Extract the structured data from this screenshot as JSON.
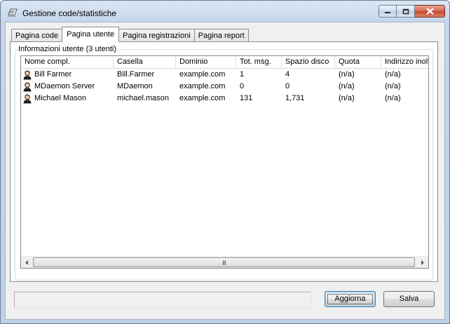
{
  "window": {
    "title": "Gestione code/statistiche"
  },
  "tabs": [
    {
      "label": "Pagina code"
    },
    {
      "label": "Pagina utente"
    },
    {
      "label": "Pagina registrazioni"
    },
    {
      "label": "Pagina report"
    }
  ],
  "active_tab": 1,
  "group": {
    "label": "Informazioni utente (3 utenti)"
  },
  "columns": [
    {
      "label": "Nome compl."
    },
    {
      "label": "Casella"
    },
    {
      "label": "Dominio"
    },
    {
      "label": "Tot. msg."
    },
    {
      "label": "Spazio disco"
    },
    {
      "label": "Quota"
    },
    {
      "label": "Indirizzo inolt"
    }
  ],
  "rows": [
    {
      "name": "Bill Farmer",
      "mailbox": "Bill.Farmer",
      "domain": "example.com",
      "messages": "1",
      "disk": "4",
      "quota": "(n/a)",
      "forward": "(n/a)"
    },
    {
      "name": "MDaemon Server",
      "mailbox": "MDaemon",
      "domain": "example.com",
      "messages": "0",
      "disk": "0",
      "quota": "(n/a)",
      "forward": "(n/a)"
    },
    {
      "name": "Michael Mason",
      "mailbox": "michael.mason",
      "domain": "example.com",
      "messages": "131",
      "disk": "1,731",
      "quota": "(n/a)",
      "forward": "(n/a)"
    }
  ],
  "buttons": {
    "refresh": "Aggiorna",
    "save": "Salva"
  },
  "scrollbar": {
    "grip": "III"
  }
}
